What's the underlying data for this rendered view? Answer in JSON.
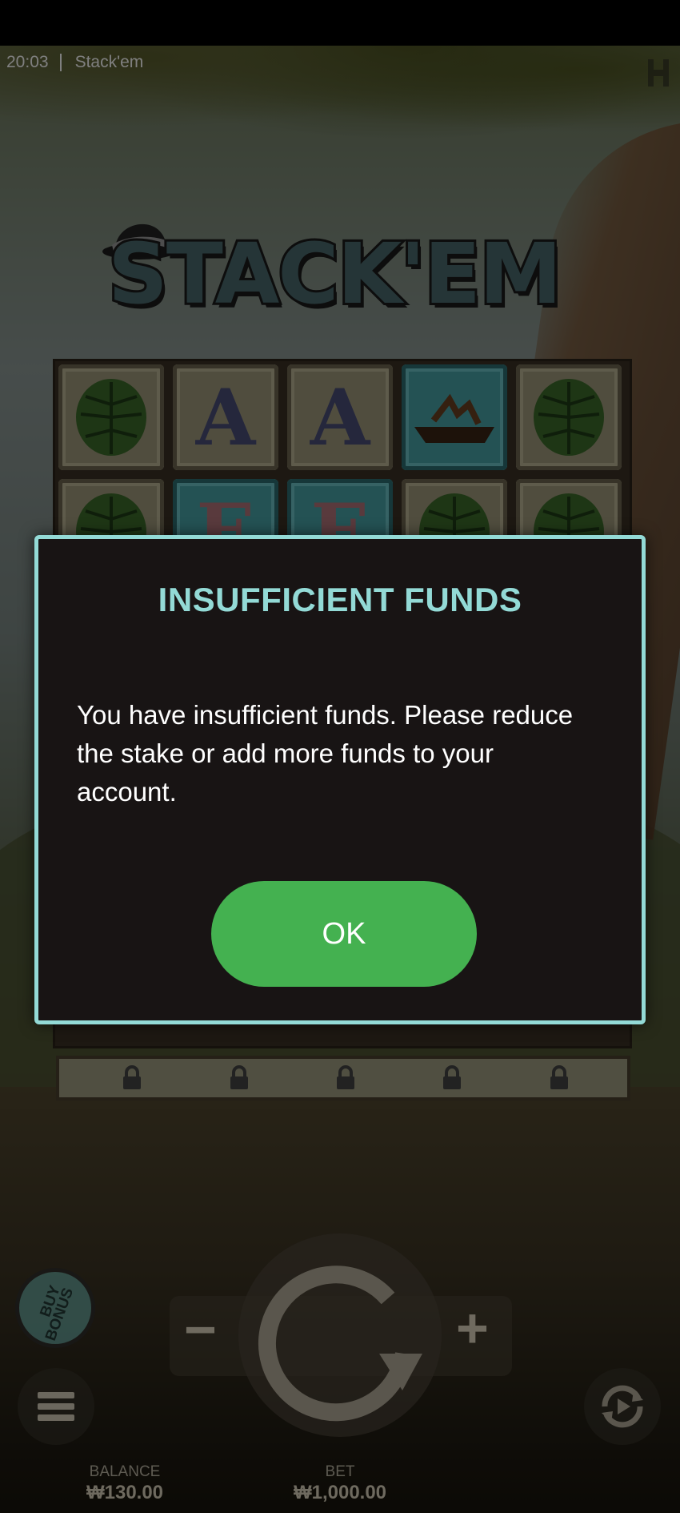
{
  "app": {
    "time": "20:03",
    "game_title": "Stack'em"
  },
  "logo": {
    "text": "STACK'EM"
  },
  "reels": {
    "row1": [
      "leaf",
      "A",
      "A",
      "chest",
      "leaf"
    ],
    "row2": [
      "leaf",
      "E",
      "E",
      "leaf",
      "leaf"
    ]
  },
  "dialog": {
    "title": "INSUFFICIENT FUNDS",
    "message": "You have insufficient funds. Please reduce the stake or add more funds to your account.",
    "ok_label": "OK"
  },
  "controls": {
    "buy_bonus_label_line1": "BUY",
    "buy_bonus_label_line2": "BONUS",
    "minus_label": "−",
    "plus_label": "+"
  },
  "footer": {
    "balance_label": "BALANCE",
    "balance_value": "₩130.00",
    "bet_label": "BET",
    "bet_value": "₩1,000.00"
  },
  "colors": {
    "accent": "#93dad6",
    "ok_button": "#44b150",
    "dialog_bg": "#181414"
  }
}
